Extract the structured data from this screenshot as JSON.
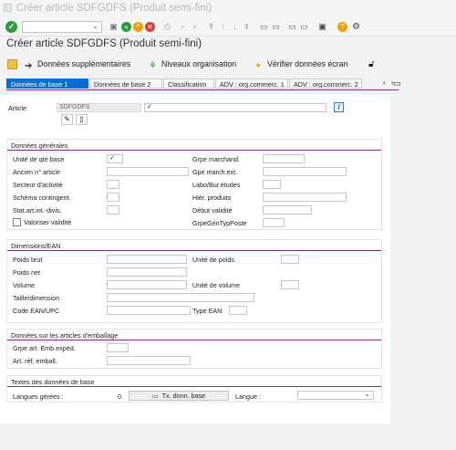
{
  "window": {
    "title": "Créer article SDFGDFS (Produit semi-fini)"
  },
  "heading": "Créer article SDFGDFS (Produit semi-fini)",
  "app_toolbar": {
    "additional_data": "Données supplémentaires",
    "org_levels": "Niveaux organisation",
    "check_screen": "Vérifier données écran"
  },
  "tabs": [
    "Données de base 1",
    "Données de base 2",
    "Classification",
    "ADV : org.commerc. 1",
    "ADV : org.commerc. 2"
  ],
  "article": {
    "label": "Article",
    "value": "SDFGDFS",
    "desc_checkmark": "✓"
  },
  "general": {
    "title": "Données générales",
    "unit_qty_base": "Unité de qté base",
    "unit_qty_base_value": "✓",
    "old_article_no": "Ancien n° article",
    "business_sector": "Secteur d'activité",
    "contingent_scheme": "Schéma contingent.",
    "stat_art_int_div": "Stat.art.int.-divis.",
    "validate_validity": "Valoriser validité",
    "goods_group": "Grpe marchand.",
    "goods_group_ext": "Gpe march.ext.",
    "lab_office": "Labo/Bur.études",
    "product_hierarchy": "Hiér. produits",
    "validity_start": "Début validité",
    "gen_item_cat_group": "GrpeGénTypPoste"
  },
  "dimensions": {
    "title": "Dimensions/EAN",
    "gross_weight": "Poids brut",
    "net_weight": "Poids net",
    "volume": "Volume",
    "size_dimension": "Taille/dimension",
    "ean_upc": "Code EAN/UPC",
    "weight_unit": "Unité de poids",
    "volume_unit": "Unité de volume",
    "ean_type": "Type EAN"
  },
  "packaging": {
    "title": "Données sur les articles d'emballage",
    "pack_group": "Grpe art. Emb.expéd.",
    "ref_art_packaging": "Art. réf. emball."
  },
  "base_texts": {
    "title": "Textes des données de base",
    "languages_managed": "Langues gérées :",
    "count": "0",
    "base_text_button": "Tx. donn. base",
    "language": "Langue :"
  },
  "colors": {
    "accent": "#0a6ed1",
    "group_line": "#8b2d8b",
    "ok_green": "#2e9b3a"
  }
}
